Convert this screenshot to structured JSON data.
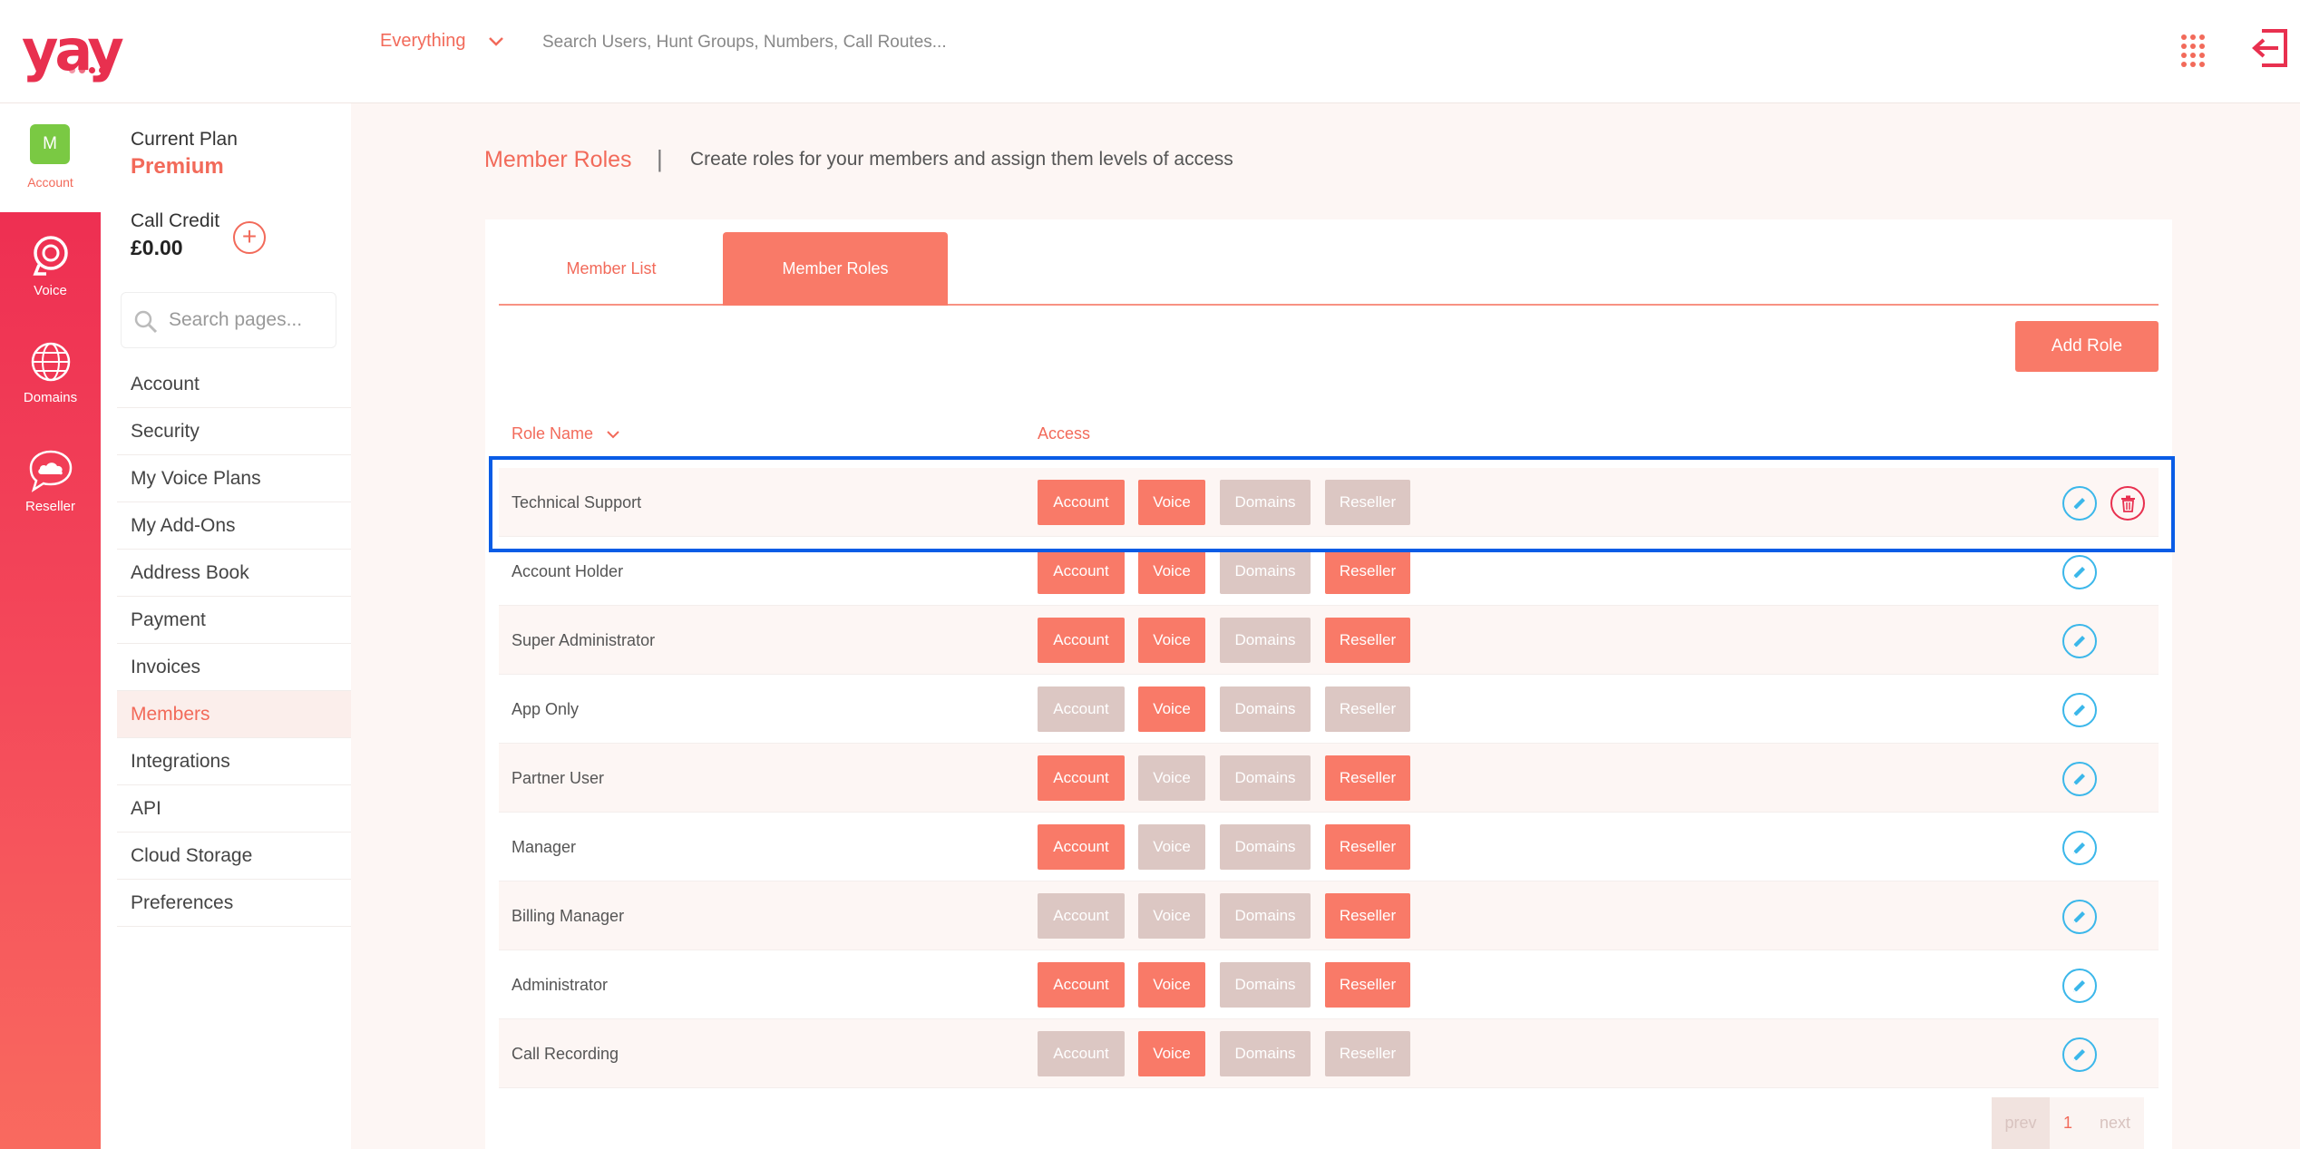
{
  "app": {
    "logo_text": "yay",
    "brand_color": "#e8304f",
    "accent_color": "#f97a68"
  },
  "topbar": {
    "scope_label": "Everything",
    "search_placeholder": "Search Users, Hunt Groups, Numbers, Call Routes...",
    "apps_icon": "grid-dots-icon",
    "logout_icon": "logout-icon"
  },
  "rail": {
    "account": {
      "avatar_initial": "M",
      "label": "Account"
    },
    "items": [
      {
        "label": "Voice",
        "icon": "headset-icon"
      },
      {
        "label": "Domains",
        "icon": "globe-icon"
      },
      {
        "label": "Reseller",
        "icon": "cloud-chat-icon"
      }
    ]
  },
  "sidebar": {
    "plan_label": "Current Plan",
    "plan_value": "Premium",
    "credit_label": "Call Credit",
    "credit_value": "£0.00",
    "credit_add": "+",
    "search_placeholder": "Search pages...",
    "items": [
      {
        "label": "Account"
      },
      {
        "label": "Security"
      },
      {
        "label": "My Voice Plans"
      },
      {
        "label": "My Add-Ons"
      },
      {
        "label": "Address Book"
      },
      {
        "label": "Payment"
      },
      {
        "label": "Invoices"
      },
      {
        "label": "Members",
        "active": true
      },
      {
        "label": "Integrations"
      },
      {
        "label": "API"
      },
      {
        "label": "Cloud Storage"
      },
      {
        "label": "Preferences"
      }
    ]
  },
  "page": {
    "title": "Member Roles",
    "separator": "|",
    "description": "Create roles for your members and assign them levels of access"
  },
  "tabs": [
    {
      "label": "Member List",
      "active": false
    },
    {
      "label": "Member Roles",
      "active": true
    }
  ],
  "actions": {
    "add_role": "Add Role"
  },
  "table": {
    "headers": {
      "role_name": "Role Name",
      "access": "Access"
    },
    "access_labels": [
      "Account",
      "Voice",
      "Domains",
      "Reseller"
    ],
    "rows": [
      {
        "name": "Technical Support",
        "access": [
          true,
          true,
          false,
          false
        ],
        "deletable": true
      },
      {
        "name": "Account Holder",
        "access": [
          true,
          true,
          false,
          true
        ],
        "deletable": false
      },
      {
        "name": "Super Administrator",
        "access": [
          true,
          true,
          false,
          true
        ],
        "deletable": false
      },
      {
        "name": "App Only",
        "access": [
          false,
          true,
          false,
          false
        ],
        "deletable": false
      },
      {
        "name": "Partner User",
        "access": [
          true,
          false,
          false,
          true
        ],
        "deletable": false
      },
      {
        "name": "Manager",
        "access": [
          true,
          false,
          false,
          true
        ],
        "deletable": false
      },
      {
        "name": "Billing Manager",
        "access": [
          false,
          false,
          false,
          true
        ],
        "deletable": false
      },
      {
        "name": "Administrator",
        "access": [
          true,
          true,
          false,
          true
        ],
        "deletable": false
      },
      {
        "name": "Call Recording",
        "access": [
          false,
          true,
          false,
          false
        ],
        "deletable": false
      }
    ]
  },
  "pagination": {
    "prev": "prev",
    "current": "1",
    "next": "next"
  }
}
